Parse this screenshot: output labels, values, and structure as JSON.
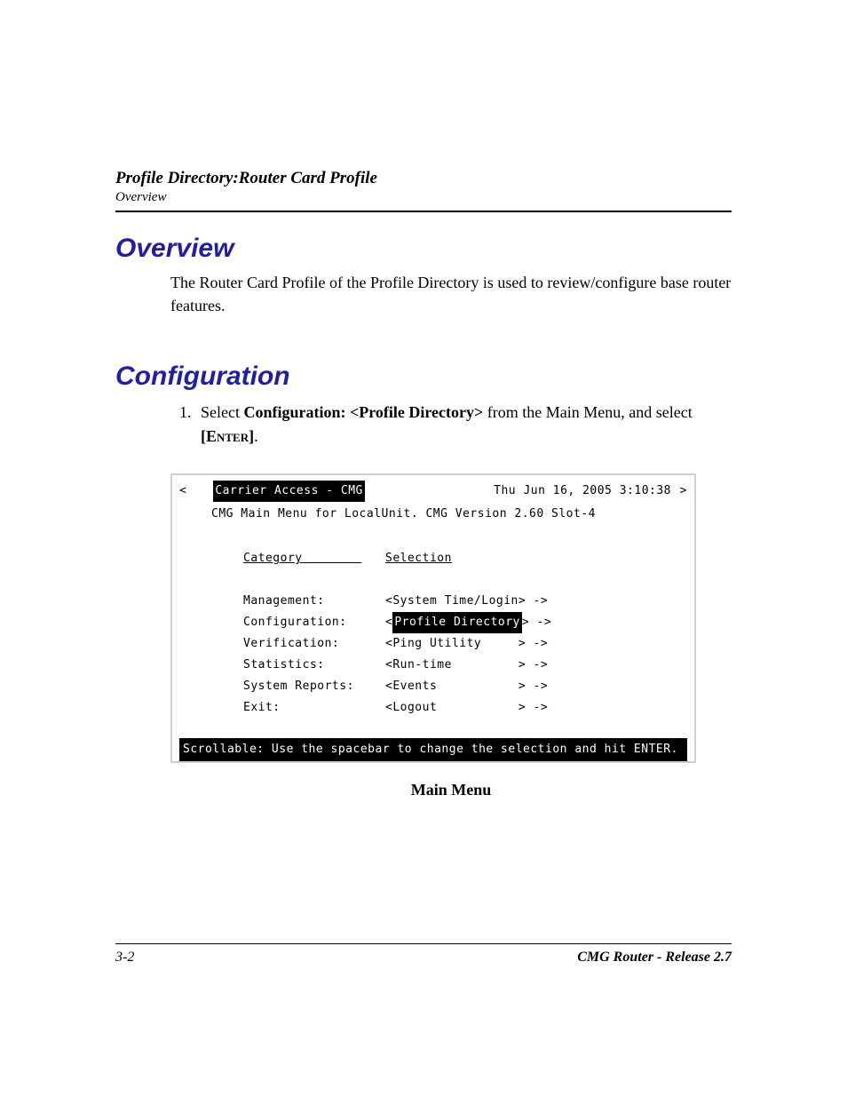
{
  "header": {
    "title": "Profile Directory:Router Card Profile",
    "subtitle": "Overview"
  },
  "sections": {
    "overview": {
      "heading": "Overview",
      "para": "The Router Card Profile of the Profile Directory is used to review/configure base router features."
    },
    "configuration": {
      "heading": "Configuration",
      "step1_pre": "Select ",
      "step1_bold": "Configuration: <Profile Directory>",
      "step1_mid": " from the Main Menu, and select ",
      "step1_key": "[Enter]",
      "step1_post": "."
    }
  },
  "terminal": {
    "top_left_arrow": "<",
    "top_right_arrow": ">",
    "app_title": "Carrier Access - CMG",
    "timestamp": "Thu Jun 16, 2005  3:10:38",
    "subtitle": "CMG Main Menu for LocalUnit.  CMG Version 2.60   Slot-4",
    "col_category": "Category",
    "col_selection": "Selection",
    "rows": [
      {
        "cat": "Management:",
        "sel": "<System Time/Login> ->",
        "highlighted": false
      },
      {
        "cat": "Configuration:",
        "sel_open": "<",
        "sel_label": "Profile Directory",
        "sel_close": "> ->",
        "highlighted": true
      },
      {
        "cat": "Verification:",
        "sel": "<Ping Utility     > ->",
        "highlighted": false
      },
      {
        "cat": "Statistics:",
        "sel": "<Run-time         > ->",
        "highlighted": false
      },
      {
        "cat": "System Reports:",
        "sel": "<Events           > ->",
        "highlighted": false
      },
      {
        "cat": "Exit:",
        "sel": "<Logout           > ->",
        "highlighted": false
      }
    ],
    "footer": "Scrollable: Use the spacebar to change the selection and hit ENTER.",
    "caption": "Main Menu"
  },
  "footer": {
    "page_num": "3-2",
    "doc_title": "CMG Router - Release 2.7"
  }
}
